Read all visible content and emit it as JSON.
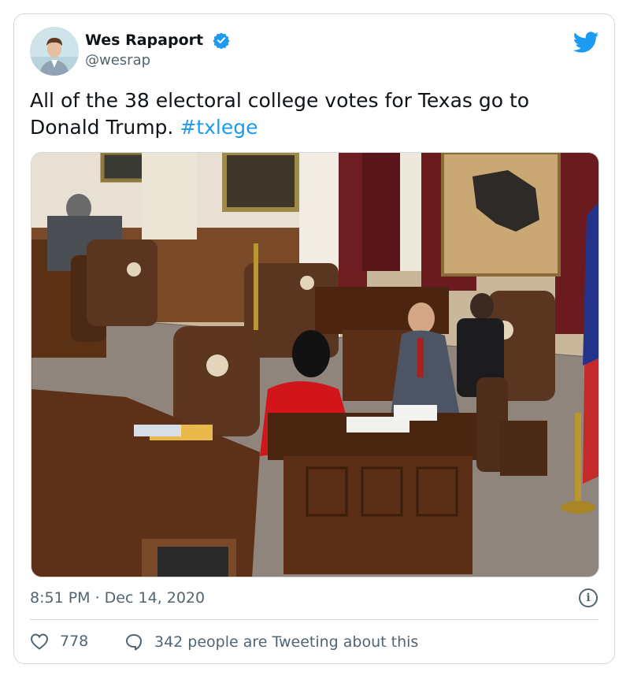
{
  "author": {
    "name": "Wes Rapaport",
    "handle": "@wesrap",
    "verified": true
  },
  "tweet": {
    "text": "All of the 38 electoral college votes for Texas go to Donald Trump.",
    "hashtag": "#txlege"
  },
  "meta": {
    "timestamp": "8:51 PM · Dec 14, 2020"
  },
  "actions": {
    "like_count": "778",
    "conversation_text": "342 people are Tweeting about this"
  },
  "colors": {
    "accent": "#1d9bf0",
    "secondary_text": "#536471",
    "border": "#cfd9de"
  },
  "icons": {
    "platform": "twitter-bird-icon",
    "verified": "verified-badge-icon",
    "info": "info-icon",
    "like": "heart-icon",
    "reply": "speech-bubble-icon"
  }
}
